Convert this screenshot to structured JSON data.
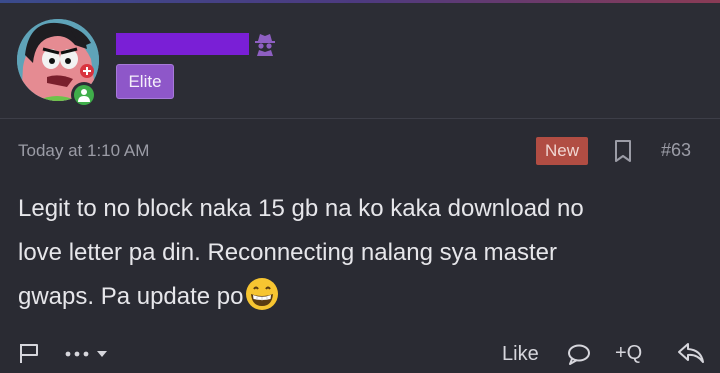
{
  "user": {
    "avatar_icon": "patrick-star-avatar-icon",
    "status": "online",
    "username_redacted_color": "#7a1fd6",
    "role_icon": "spy-icon",
    "badge_label": "Elite",
    "badge_color": "#8e57c9"
  },
  "post": {
    "timestamp": "Today at 1:10 AM",
    "new_label": "New",
    "new_color": "#b14d43",
    "bookmark_icon": "bookmark-icon",
    "number": "#63",
    "message_line_1": "Legit to no block naka 15 gb na ko kaka download no",
    "message_line_2": "love letter pa din. Reconnecting nalang sya master",
    "message_line_3": "gwaps. Pa update po",
    "emoji": "grinning-face-emoji"
  },
  "actions": {
    "report_icon": "flag-icon",
    "more_icon": "ellipsis-dropdown-icon",
    "like_label": "Like",
    "comment_icon": "comment-icon",
    "quote_label": "+Q",
    "reply_icon": "reply-arrow-icon"
  }
}
